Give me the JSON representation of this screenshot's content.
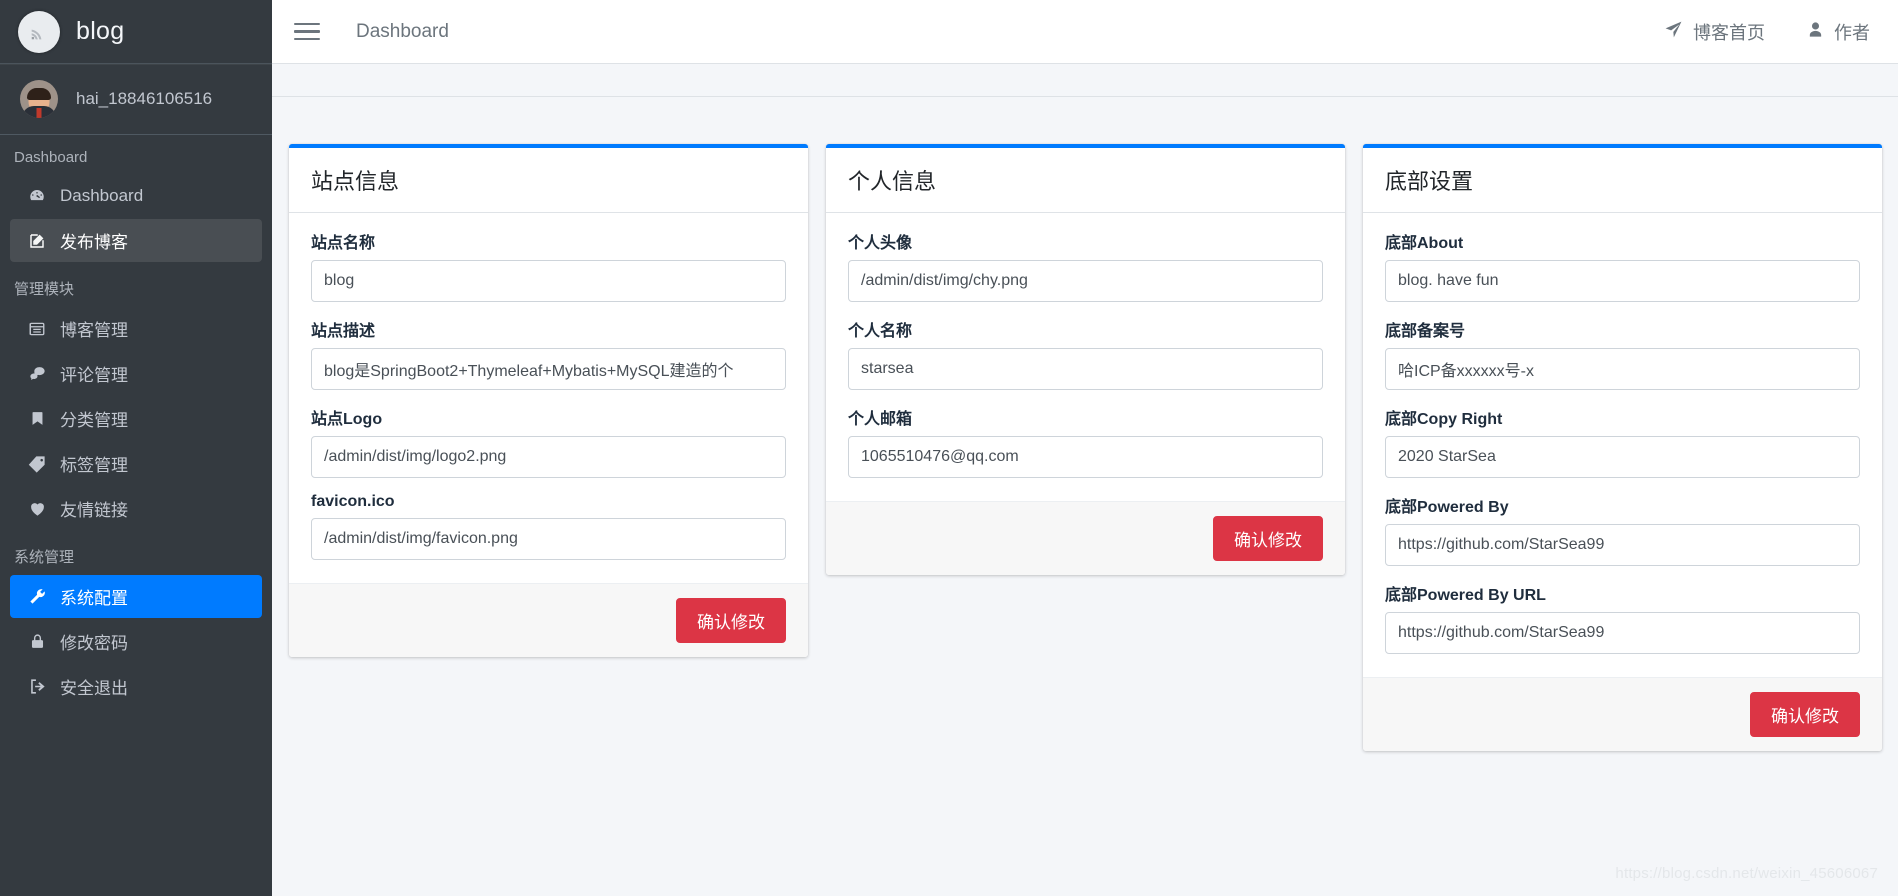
{
  "sidebar": {
    "brand": {
      "title": "blog",
      "logo_icon": "blog-logo-icon"
    },
    "user": {
      "name": "hai_18846106516",
      "avatar_icon": "user-avatar"
    },
    "sections": [
      {
        "header": "Dashboard",
        "items": [
          {
            "label": "Dashboard",
            "icon": "dashboard-icon",
            "state": "normal"
          },
          {
            "label": "发布博客",
            "icon": "edit-icon",
            "state": "hovered"
          }
        ]
      },
      {
        "header": "管理模块",
        "items": [
          {
            "label": "博客管理",
            "icon": "list-icon",
            "state": "normal"
          },
          {
            "label": "评论管理",
            "icon": "comment-icon",
            "state": "normal"
          },
          {
            "label": "分类管理",
            "icon": "bookmark-icon",
            "state": "normal"
          },
          {
            "label": "标签管理",
            "icon": "tag-icon",
            "state": "normal"
          },
          {
            "label": "友情链接",
            "icon": "heart-icon",
            "state": "normal"
          }
        ]
      },
      {
        "header": "系统管理",
        "items": [
          {
            "label": "系统配置",
            "icon": "wrench-icon",
            "state": "active"
          },
          {
            "label": "修改密码",
            "icon": "lock-icon",
            "state": "normal"
          },
          {
            "label": "安全退出",
            "icon": "signout-icon",
            "state": "normal"
          }
        ]
      }
    ]
  },
  "header": {
    "menu_toggle_icon": "hamburger-icon",
    "breadcrumb": "Dashboard",
    "links": [
      {
        "label": "博客首页",
        "icon": "paper-plane-icon"
      },
      {
        "label": "作者",
        "icon": "user-icon"
      }
    ]
  },
  "cards": [
    {
      "title": "站点信息",
      "fields": [
        {
          "label": "站点名称",
          "value": "blog"
        },
        {
          "label": "站点描述",
          "value": "blog是SpringBoot2+Thymeleaf+Mybatis+MySQL建造的个"
        },
        {
          "label": "站点Logo",
          "value": "/admin/dist/img/logo2.png"
        },
        {
          "label": "favicon.ico",
          "value": "/admin/dist/img/favicon.png"
        }
      ],
      "submit_label": "确认修改"
    },
    {
      "title": "个人信息",
      "fields": [
        {
          "label": "个人头像",
          "value": "/admin/dist/img/chy.png"
        },
        {
          "label": "个人名称",
          "value": "starsea"
        },
        {
          "label": "个人邮箱",
          "value": "1065510476@qq.com"
        }
      ],
      "submit_label": "确认修改"
    },
    {
      "title": "底部设置",
      "fields": [
        {
          "label": "底部About",
          "value": "blog. have fun"
        },
        {
          "label": "底部备案号",
          "value": "哈ICP备xxxxxx号-x"
        },
        {
          "label": "底部Copy Right",
          "value": "2020 StarSea"
        },
        {
          "label": "底部Powered By",
          "value": "https://github.com/StarSea99"
        },
        {
          "label": "底部Powered By URL",
          "value": "https://github.com/StarSea99"
        }
      ],
      "submit_label": "确认修改"
    }
  ],
  "watermark": "https://blog.csdn.net/weixin_45606067",
  "colors": {
    "sidebar_bg": "#343a40",
    "accent": "#007bff",
    "danger": "#dc3545",
    "content_bg": "#f4f6f9"
  }
}
